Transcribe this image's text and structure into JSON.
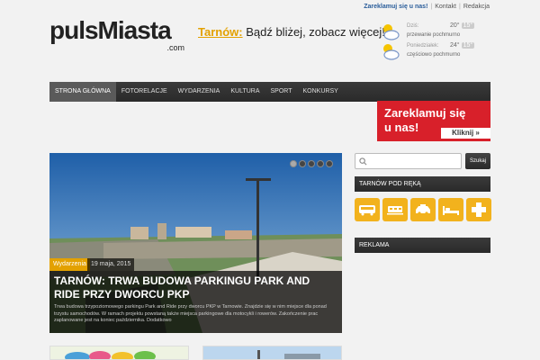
{
  "toplinks": [
    "Zareklamuj się u nas!",
    "Kontakt",
    "Redakcja"
  ],
  "logo": {
    "text": "pulsMiasta",
    "sub": ".com"
  },
  "tagline": {
    "city": "Tarnów:",
    "text": " Bądź bliżej, zobacz więcej!"
  },
  "weather": [
    {
      "day": "Dziś:",
      "temp": "20°",
      "hi": "15°",
      "desc": "przewanie pochmurno",
      "icon": "partly-cloudy-icon"
    },
    {
      "day": "Poniedziałek:",
      "temp": "24°",
      "hi": "15°",
      "desc": "częściowo pochmurno",
      "icon": "partly-cloudy-icon"
    }
  ],
  "nav": [
    "STRONA GŁÓWNA",
    "FOTORELACJE",
    "WYDARZENIA",
    "KULTURA",
    "SPORT",
    "KONKURSY"
  ],
  "ad": {
    "line1": "Zareklamuj się",
    "line2": "u nas!",
    "button": "Kliknij »"
  },
  "slider": {
    "category": "Wydarzenia",
    "date": "19 maja, 2015",
    "title": "TARNÓW: TRWA BUDOWA PARKINGU PARK AND RIDE PRZY DWORCU PKP",
    "excerpt": "Trwa budowa trzypoziomowego parkingu Park and Ride przy dworcu PKP w Tarnowie. Znajdzie się w nim miejsce dla ponad trzystu samochodów. W ramach projektu powstaną także miejsca parkingowe dla motocykli i rowerów. Zakończenie prac zaplanowane jest na koniec października. Dodatkowo"
  },
  "search": {
    "button": "Szukaj",
    "icon": "search-icon"
  },
  "sidebar": {
    "handy_title": "TARNÓW POD RĘKĄ",
    "ads_title": "REKLAMA"
  },
  "tiles": [
    "bus-icon",
    "train-icon",
    "taxi-icon",
    "hotel-icon",
    "hospital-icon"
  ],
  "colors": {
    "accent": "#e3a100",
    "tile": "#f2b21d",
    "ad": "#d8202a",
    "nav": "#333333"
  }
}
